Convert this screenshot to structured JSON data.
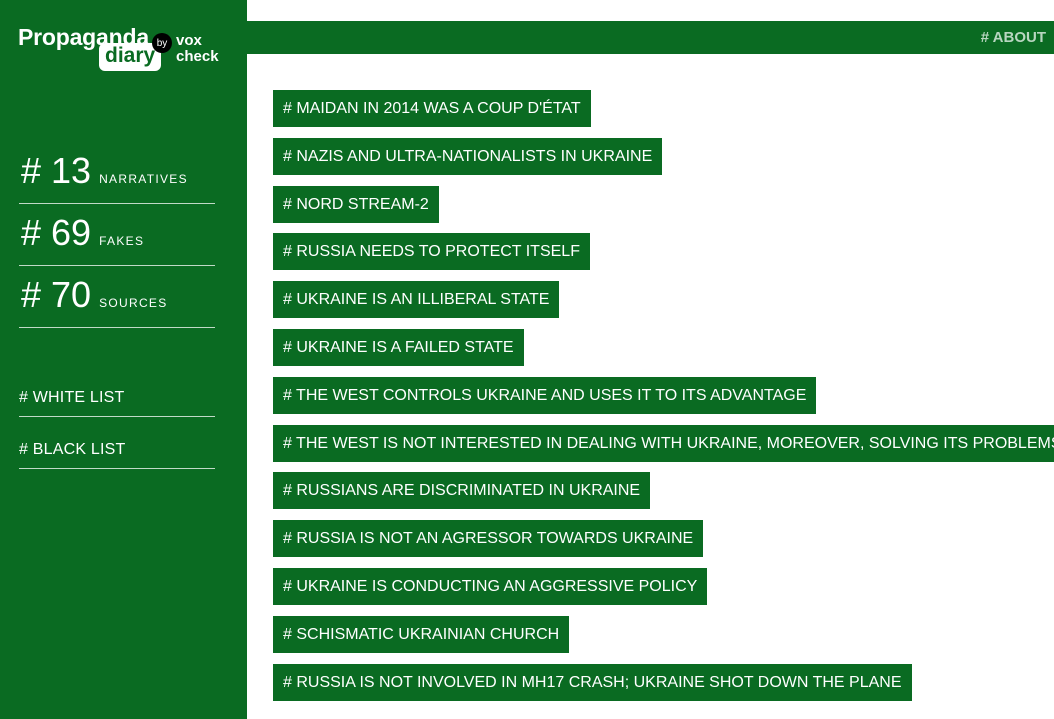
{
  "brand": {
    "title": "Propaganda",
    "subtitle": "diary",
    "by": "by",
    "partner_line1": "vox",
    "partner_line2": "check"
  },
  "stats": [
    {
      "number": "# 13",
      "label": "NARRATIVES"
    },
    {
      "number": "# 69",
      "label": "FAKES"
    },
    {
      "number": "# 70",
      "label": "SOURCES"
    }
  ],
  "lists": {
    "white": "# WHITE LIST",
    "black": "# BLACK LIST"
  },
  "header": {
    "about": "# ABOUT"
  },
  "narratives": [
    "# MAIDAN IN 2014 WAS A COUP D'ÉTAT",
    "# NAZIS AND ULTRA-NATIONALISTS IN UKRAINE",
    "# NORD STREAM-2",
    "# RUSSIA NEEDS TO PROTECT ITSELF",
    "# UKRAINE IS AN ILLIBERAL STATE",
    "# UKRAINE IS A FAILED STATE",
    "# THE WEST CONTROLS UKRAINE AND USES IT TO ITS ADVANTAGE",
    "# THE WEST IS NOT INTERESTED IN DEALING WITH UKRAINE, MOREOVER, SOLVING ITS PROBLEMS.",
    "# RUSSIANS ARE DISCRIMINATED IN UKRAINE",
    "# RUSSIA IS NOT AN AGRESSOR TOWARDS UKRAINE",
    "# UKRAINE IS CONDUCTING AN AGGRESSIVE POLICY",
    "# SCHISMATIC UKRAINIAN CHURCH",
    "# RUSSIA IS NOT INVOLVED IN MH17 CRASH; UKRAINE SHOT DOWN THE PLANE"
  ],
  "colors": {
    "brand_green": "#0a6b22",
    "text_white": "#ffffff",
    "about_text": "#b8d6c0"
  }
}
